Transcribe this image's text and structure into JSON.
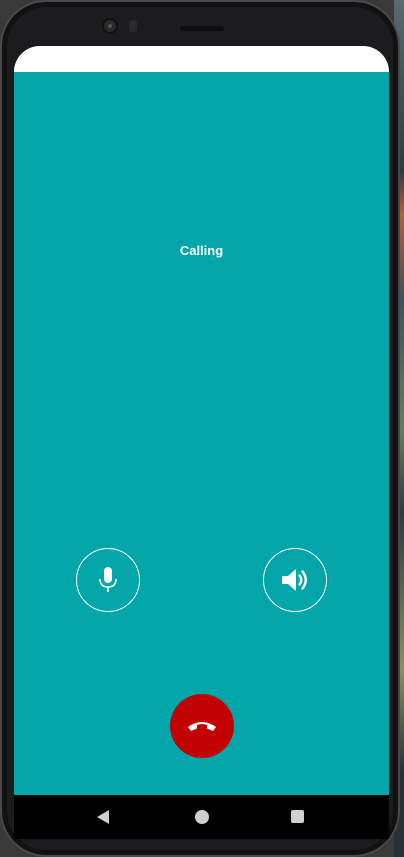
{
  "call": {
    "status_text": "Calling"
  },
  "controls": {
    "mute_icon": "microphone-icon",
    "speaker_icon": "speaker-volume-icon",
    "hangup_icon": "phone-hangup-icon"
  },
  "nav": {
    "back_icon": "back-triangle-icon",
    "home_icon": "home-circle-icon",
    "recents_icon": "recents-square-icon"
  },
  "colors": {
    "background": "#01a5aa",
    "hangup": "#c20202",
    "foreground": "#ffffff"
  }
}
